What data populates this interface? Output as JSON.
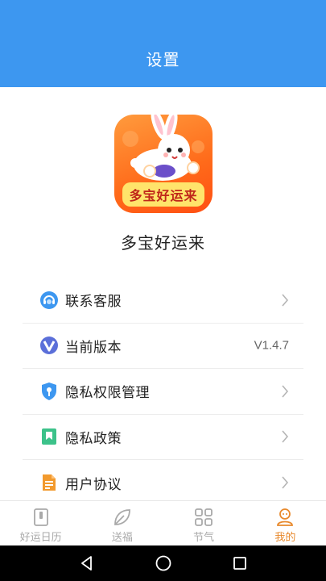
{
  "header": {
    "title": "设置"
  },
  "app": {
    "icon_name": "rabbit-app-icon",
    "icon_text": "多宝好运来",
    "name": "多宝好运来"
  },
  "menu": [
    {
      "icon": "customer-service-icon",
      "label": "联系客服",
      "value": ""
    },
    {
      "icon": "version-icon",
      "label": "当前版本",
      "value": "V1.4.7"
    },
    {
      "icon": "privacy-shield-icon",
      "label": "隐私权限管理",
      "value": ""
    },
    {
      "icon": "bookmark-icon",
      "label": "隐私政策",
      "value": ""
    },
    {
      "icon": "document-icon",
      "label": "用户协议",
      "value": ""
    }
  ],
  "tabbar": [
    {
      "label": "好运日历",
      "icon": "calendar-icon",
      "active": false
    },
    {
      "label": "送福",
      "icon": "leaf-icon",
      "active": false
    },
    {
      "label": "节气",
      "icon": "grid-icon",
      "active": false
    },
    {
      "label": "我的",
      "icon": "profile-icon",
      "active": true
    }
  ],
  "colors": {
    "header": "#3d97f0",
    "active_tab": "#e8892c",
    "inactive_tab": "#a9a9a9"
  },
  "system_nav": [
    "back-icon",
    "home-icon",
    "recents-icon"
  ]
}
